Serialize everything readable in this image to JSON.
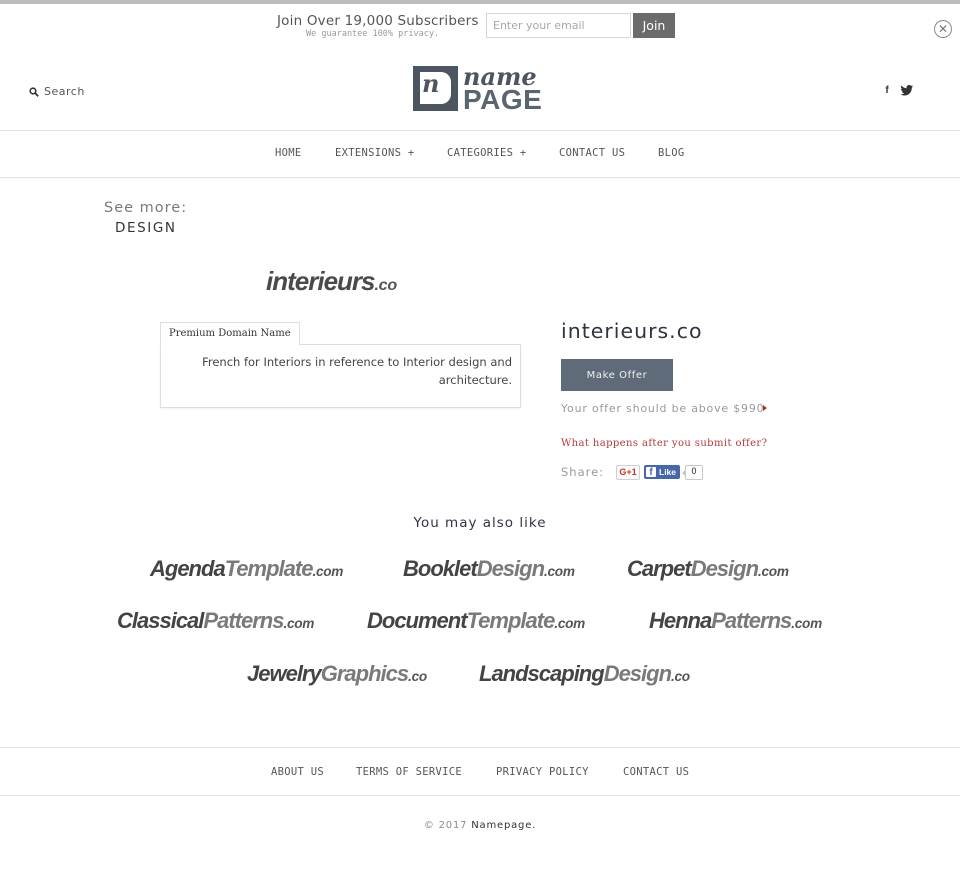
{
  "newsletter": {
    "title": "Join Over 19,000 Subscribers",
    "subtitle": "We guarantee 100% privacy.",
    "email_placeholder": "Enter your email",
    "email_value": "",
    "join_label": "Join",
    "close_icon": "close-circle-icon"
  },
  "header": {
    "search_label": "Search",
    "search_icon": "search-icon",
    "logo": {
      "letter": "n",
      "word_top": "name",
      "word_bottom": "PAGE"
    },
    "social": [
      {
        "name": "facebook",
        "glyph": "f"
      },
      {
        "name": "twitter",
        "glyph": "twitter-bird"
      }
    ]
  },
  "nav": {
    "items": [
      {
        "label": "HOME"
      },
      {
        "label": "EXTENSIONS +"
      },
      {
        "label": "CATEGORIES +"
      },
      {
        "label": "CONTACT US"
      },
      {
        "label": "BLOG"
      }
    ]
  },
  "see_more": {
    "label": "See more:",
    "category": "DESIGN"
  },
  "domain": {
    "logo_main": "interieurs",
    "logo_tld": ".co",
    "tab_label": "Premium Domain Name",
    "description": "French for Interiors in reference to Interior design and architecture.",
    "name": "interieurs.co",
    "make_offer_label": "Make Offer",
    "offer_note": "Your offer should be above $990",
    "offer_help": "What happens after you submit offer?",
    "share_label": "Share:",
    "gplus_label": "G+1",
    "fb_like_label": "Like",
    "fb_like_count": "0"
  },
  "related": {
    "title": "You may also like",
    "items": [
      {
        "a": "Agenda",
        "b": "Template",
        "tld": ".com"
      },
      {
        "a": "Booklet",
        "b": "Design",
        "tld": ".com"
      },
      {
        "a": "Carpet",
        "b": "Design",
        "tld": ".com"
      },
      {
        "a": "Classical",
        "b": "Patterns",
        "tld": ".com"
      },
      {
        "a": "Document",
        "b": "Template",
        "tld": ".com"
      },
      {
        "a": "Henna",
        "b": "Patterns",
        "tld": ".com"
      },
      {
        "a": "Jewelry",
        "b": "Graphics",
        "tld": ".co"
      },
      {
        "a": "Landscaping",
        "b": "Design",
        "tld": ".co"
      }
    ]
  },
  "footer": {
    "links": [
      {
        "label": "ABOUT US"
      },
      {
        "label": "TERMS OF SERVICE"
      },
      {
        "label": "PRIVACY POLICY"
      },
      {
        "label": "CONTACT US"
      }
    ],
    "copyright_prefix": "© 2017",
    "copyright_brand": "Namepage."
  }
}
